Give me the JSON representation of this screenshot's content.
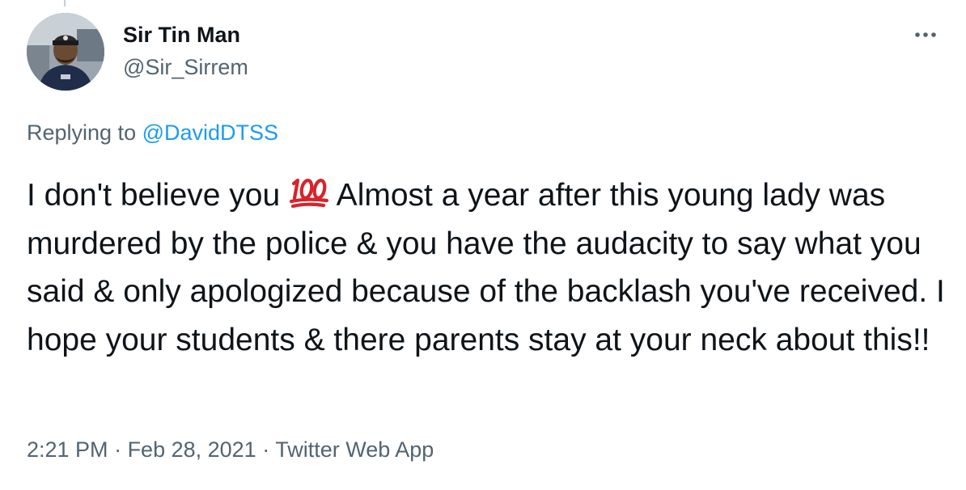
{
  "tweet": {
    "author": {
      "display_name": "Sir Tin Man",
      "handle": "@Sir_Sirrem",
      "avatar_icon": "profile-photo-avatar"
    },
    "more_icon": "more-options-icon",
    "reply_context": {
      "prefix": "Replying to ",
      "mention": "@DavidDTSS"
    },
    "text": {
      "before_emoji": "I don't believe you ",
      "emoji": "hundred-points-emoji",
      "after_emoji": " Almost a year after this young lady was murdered by the police & you have the audacity to say what you said & only apologized because of the backlash you've received. I hope your students & there parents stay at your neck about this!!"
    },
    "meta": {
      "time": "2:21 PM",
      "separator": " · ",
      "date": "Feb 28, 2021",
      "source": "Twitter Web App"
    }
  },
  "colors": {
    "text_primary": "#0f1419",
    "text_secondary": "#536471",
    "link": "#1d9bf0",
    "emoji_red": "#d8232a"
  }
}
